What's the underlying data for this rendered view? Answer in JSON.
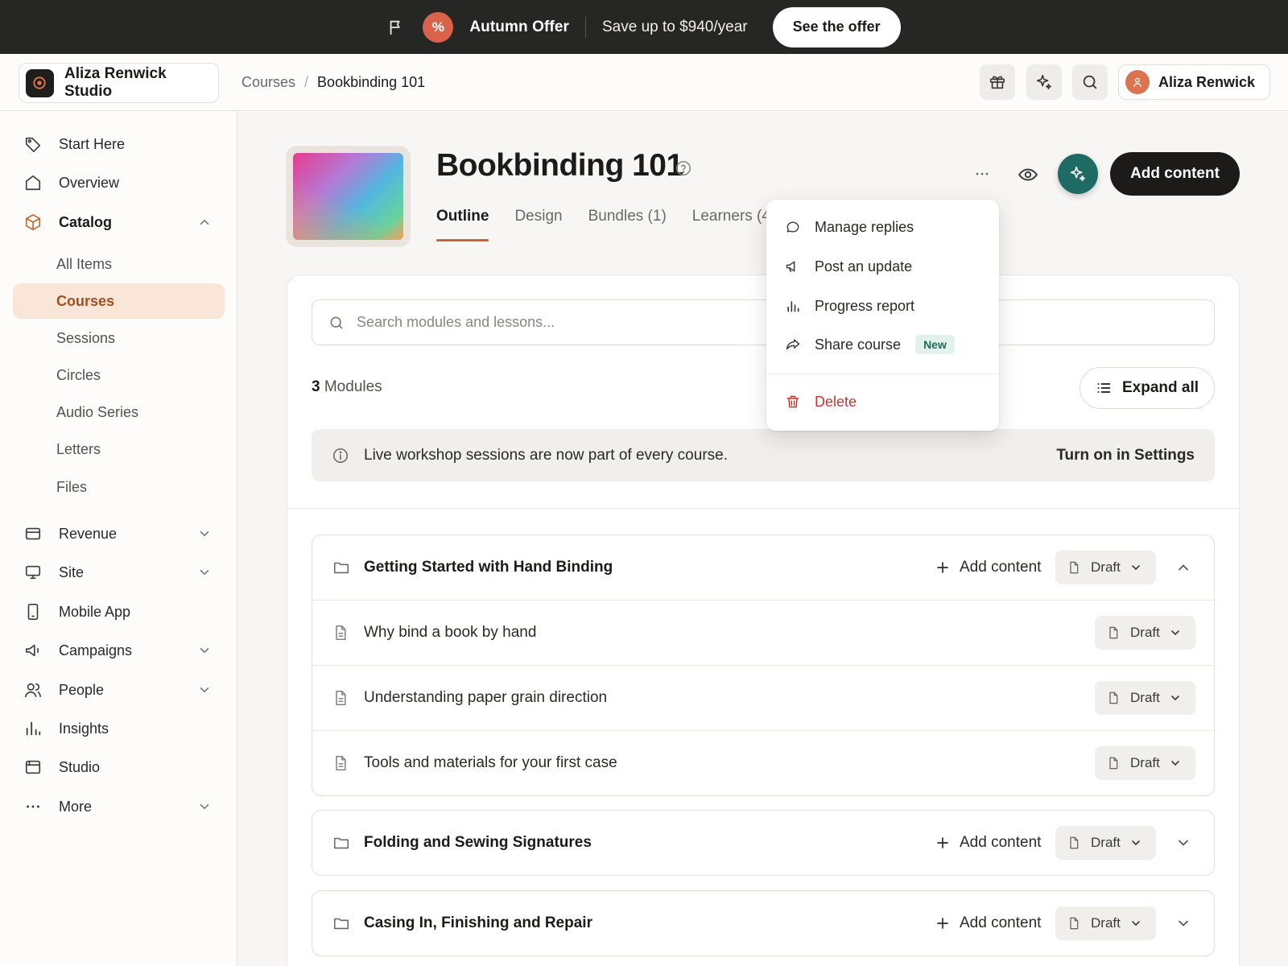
{
  "promo": {
    "title": "Autumn Offer",
    "badge_symbol": "%",
    "savings": "Save up to $940/year",
    "cta": "See the offer"
  },
  "header": {
    "studio_name": "Aliza Renwick Studio",
    "breadcrumb": [
      "Courses",
      "/",
      "Bookbinding 101"
    ],
    "user_name": "Aliza Renwick"
  },
  "sidebar": {
    "items": [
      {
        "label": "Start Here",
        "icon": "tag-icon"
      },
      {
        "label": "Overview",
        "icon": "home-icon"
      },
      {
        "label": "Catalog",
        "icon": "box-icon"
      },
      {
        "label": "Revenue",
        "icon": "card-icon"
      },
      {
        "label": "Site",
        "icon": "monitor-icon"
      },
      {
        "label": "Mobile App",
        "icon": "phone-icon"
      },
      {
        "label": "Campaigns",
        "icon": "megaphone-icon"
      },
      {
        "label": "People",
        "icon": "people-icon"
      },
      {
        "label": "Insights",
        "icon": "bar-chart-icon"
      },
      {
        "label": "Studio",
        "icon": "browser-icon"
      },
      {
        "label": "More",
        "icon": "dots-icon"
      }
    ],
    "catalog_sub": [
      "All Items",
      "Courses",
      "Sessions",
      "Circles",
      "Audio Series",
      "Letters",
      "Files"
    ]
  },
  "course": {
    "title": "Bookbinding 101",
    "tabs": [
      "Outline",
      "Design",
      "Bundles (1)",
      "Learners (4"
    ],
    "add_content": "Add content"
  },
  "outline": {
    "search_placeholder": "Search modules and lessons...",
    "module_count": "3",
    "module_count_label": "Modules",
    "expand_all": "Expand all",
    "notice": "Live workshop sessions are now part of every course.",
    "notice_link": "Turn on in Settings",
    "add_content": "Add content",
    "draft_label": "Draft",
    "modules": [
      {
        "title": "Getting Started with Hand Binding",
        "lessons": [
          "Why bind a book by hand",
          "Understanding paper grain direction",
          "Tools and materials for your first case"
        ]
      },
      {
        "title": "Folding and Sewing Signatures"
      },
      {
        "title": "Casing In, Finishing and Repair"
      }
    ]
  },
  "menu": {
    "items": [
      "Manage replies",
      "Post an update",
      "Progress report",
      "Share course"
    ],
    "new_badge": "New",
    "delete": "Delete"
  },
  "colors": {
    "accent": "#c4662f",
    "ai_button": "#1e6b63",
    "danger": "#c4362f",
    "promo_bg": "#262624"
  }
}
